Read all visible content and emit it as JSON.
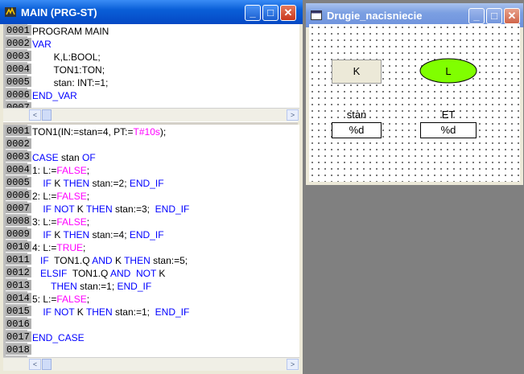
{
  "main_window": {
    "title": "MAIN (PRG-ST)",
    "buttons": {
      "minimize": "_",
      "maximize": "□",
      "close": "✕"
    }
  },
  "declaration": {
    "lines": [
      {
        "num": "0001",
        "segs": [
          {
            "t": "PROGRAM MAIN",
            "c": ""
          }
        ]
      },
      {
        "num": "0002",
        "segs": [
          {
            "t": "VAR",
            "c": "kw"
          }
        ]
      },
      {
        "num": "0003",
        "segs": [
          {
            "t": "        K,L:BOOL;",
            "c": ""
          }
        ]
      },
      {
        "num": "0004",
        "segs": [
          {
            "t": "        TON1:TON;",
            "c": ""
          }
        ]
      },
      {
        "num": "0005",
        "segs": [
          {
            "t": "        stan: INT:=1;",
            "c": ""
          }
        ]
      },
      {
        "num": "0006",
        "segs": [
          {
            "t": "END_VAR",
            "c": "kw"
          }
        ]
      },
      {
        "num": "0007",
        "segs": []
      }
    ]
  },
  "body": {
    "lines": [
      {
        "num": "0001",
        "segs": [
          {
            "t": "TON1(IN:=stan=4, PT:=",
            "c": ""
          },
          {
            "t": "T#10s",
            "c": "lit"
          },
          {
            "t": ");",
            "c": ""
          }
        ]
      },
      {
        "num": "0002",
        "segs": []
      },
      {
        "num": "0003",
        "segs": [
          {
            "t": "CASE",
            "c": "kw"
          },
          {
            "t": " stan ",
            "c": ""
          },
          {
            "t": "OF",
            "c": "kw"
          }
        ]
      },
      {
        "num": "0004",
        "segs": [
          {
            "t": "1: L:=",
            "c": ""
          },
          {
            "t": "FALSE",
            "c": "lit"
          },
          {
            "t": ";",
            "c": ""
          }
        ]
      },
      {
        "num": "0005",
        "segs": [
          {
            "t": "    ",
            "c": ""
          },
          {
            "t": "IF",
            "c": "kw"
          },
          {
            "t": " K ",
            "c": ""
          },
          {
            "t": "THEN",
            "c": "kw"
          },
          {
            "t": " stan:=2; ",
            "c": ""
          },
          {
            "t": "END_IF",
            "c": "kw"
          }
        ]
      },
      {
        "num": "0006",
        "segs": [
          {
            "t": "2: L:=",
            "c": ""
          },
          {
            "t": "FALSE",
            "c": "lit"
          },
          {
            "t": ";",
            "c": ""
          }
        ]
      },
      {
        "num": "0007",
        "segs": [
          {
            "t": "    ",
            "c": ""
          },
          {
            "t": "IF NOT",
            "c": "kw"
          },
          {
            "t": " K ",
            "c": ""
          },
          {
            "t": "THEN",
            "c": "kw"
          },
          {
            "t": " stan:=3;  ",
            "c": ""
          },
          {
            "t": "END_IF",
            "c": "kw"
          }
        ]
      },
      {
        "num": "0008",
        "segs": [
          {
            "t": "3: L:=",
            "c": ""
          },
          {
            "t": "FALSE",
            "c": "lit"
          },
          {
            "t": ";",
            "c": ""
          }
        ]
      },
      {
        "num": "0009",
        "segs": [
          {
            "t": "    ",
            "c": ""
          },
          {
            "t": "IF",
            "c": "kw"
          },
          {
            "t": " K ",
            "c": ""
          },
          {
            "t": "THEN",
            "c": "kw"
          },
          {
            "t": " stan:=4; ",
            "c": ""
          },
          {
            "t": "END_IF",
            "c": "kw"
          }
        ]
      },
      {
        "num": "0010",
        "segs": [
          {
            "t": "4: L:=",
            "c": ""
          },
          {
            "t": "TRUE",
            "c": "lit"
          },
          {
            "t": ";",
            "c": ""
          }
        ]
      },
      {
        "num": "0011",
        "segs": [
          {
            "t": "   ",
            "c": ""
          },
          {
            "t": "IF",
            "c": "kw"
          },
          {
            "t": "  TON1.Q ",
            "c": ""
          },
          {
            "t": "AND",
            "c": "kw"
          },
          {
            "t": " K ",
            "c": ""
          },
          {
            "t": "THEN",
            "c": "kw"
          },
          {
            "t": " stan:=5;",
            "c": ""
          }
        ]
      },
      {
        "num": "0012",
        "segs": [
          {
            "t": "   ",
            "c": ""
          },
          {
            "t": "ELSIF",
            "c": "kw"
          },
          {
            "t": "  TON1.Q ",
            "c": ""
          },
          {
            "t": "AND",
            "c": "kw"
          },
          {
            "t": "  ",
            "c": ""
          },
          {
            "t": "NOT",
            "c": "kw"
          },
          {
            "t": " K",
            "c": ""
          }
        ]
      },
      {
        "num": "0013",
        "segs": [
          {
            "t": "       ",
            "c": ""
          },
          {
            "t": "THEN",
            "c": "kw"
          },
          {
            "t": " stan:=1; ",
            "c": ""
          },
          {
            "t": "END_IF",
            "c": "kw"
          }
        ]
      },
      {
        "num": "0014",
        "segs": [
          {
            "t": "5: L:=",
            "c": ""
          },
          {
            "t": "FALSE",
            "c": "lit"
          },
          {
            "t": ";",
            "c": ""
          }
        ]
      },
      {
        "num": "0015",
        "segs": [
          {
            "t": "    ",
            "c": ""
          },
          {
            "t": "IF NOT",
            "c": "kw"
          },
          {
            "t": " K ",
            "c": ""
          },
          {
            "t": "THEN",
            "c": "kw"
          },
          {
            "t": " stan:=1;  ",
            "c": ""
          },
          {
            "t": "END_IF",
            "c": "kw"
          }
        ]
      },
      {
        "num": "0016",
        "segs": []
      },
      {
        "num": "0017",
        "segs": [
          {
            "t": "END_CASE",
            "c": "kw"
          }
        ]
      },
      {
        "num": "0018",
        "segs": []
      }
    ]
  },
  "scroll": {
    "left": "<",
    "right": ">"
  },
  "vis_window": {
    "title": "Drugie_nacisniecie",
    "buttons": {
      "minimize": "_",
      "maximize": "□",
      "close": "✕"
    },
    "button_k": "K",
    "lamp_l": "L",
    "lamp_color": "#80ff00",
    "label_stan": "stan",
    "label_et": "ET",
    "field_stan": "%d",
    "field_et": "%d"
  },
  "colors": {
    "keyword": "#0000ff",
    "literal": "#ff00ff"
  }
}
